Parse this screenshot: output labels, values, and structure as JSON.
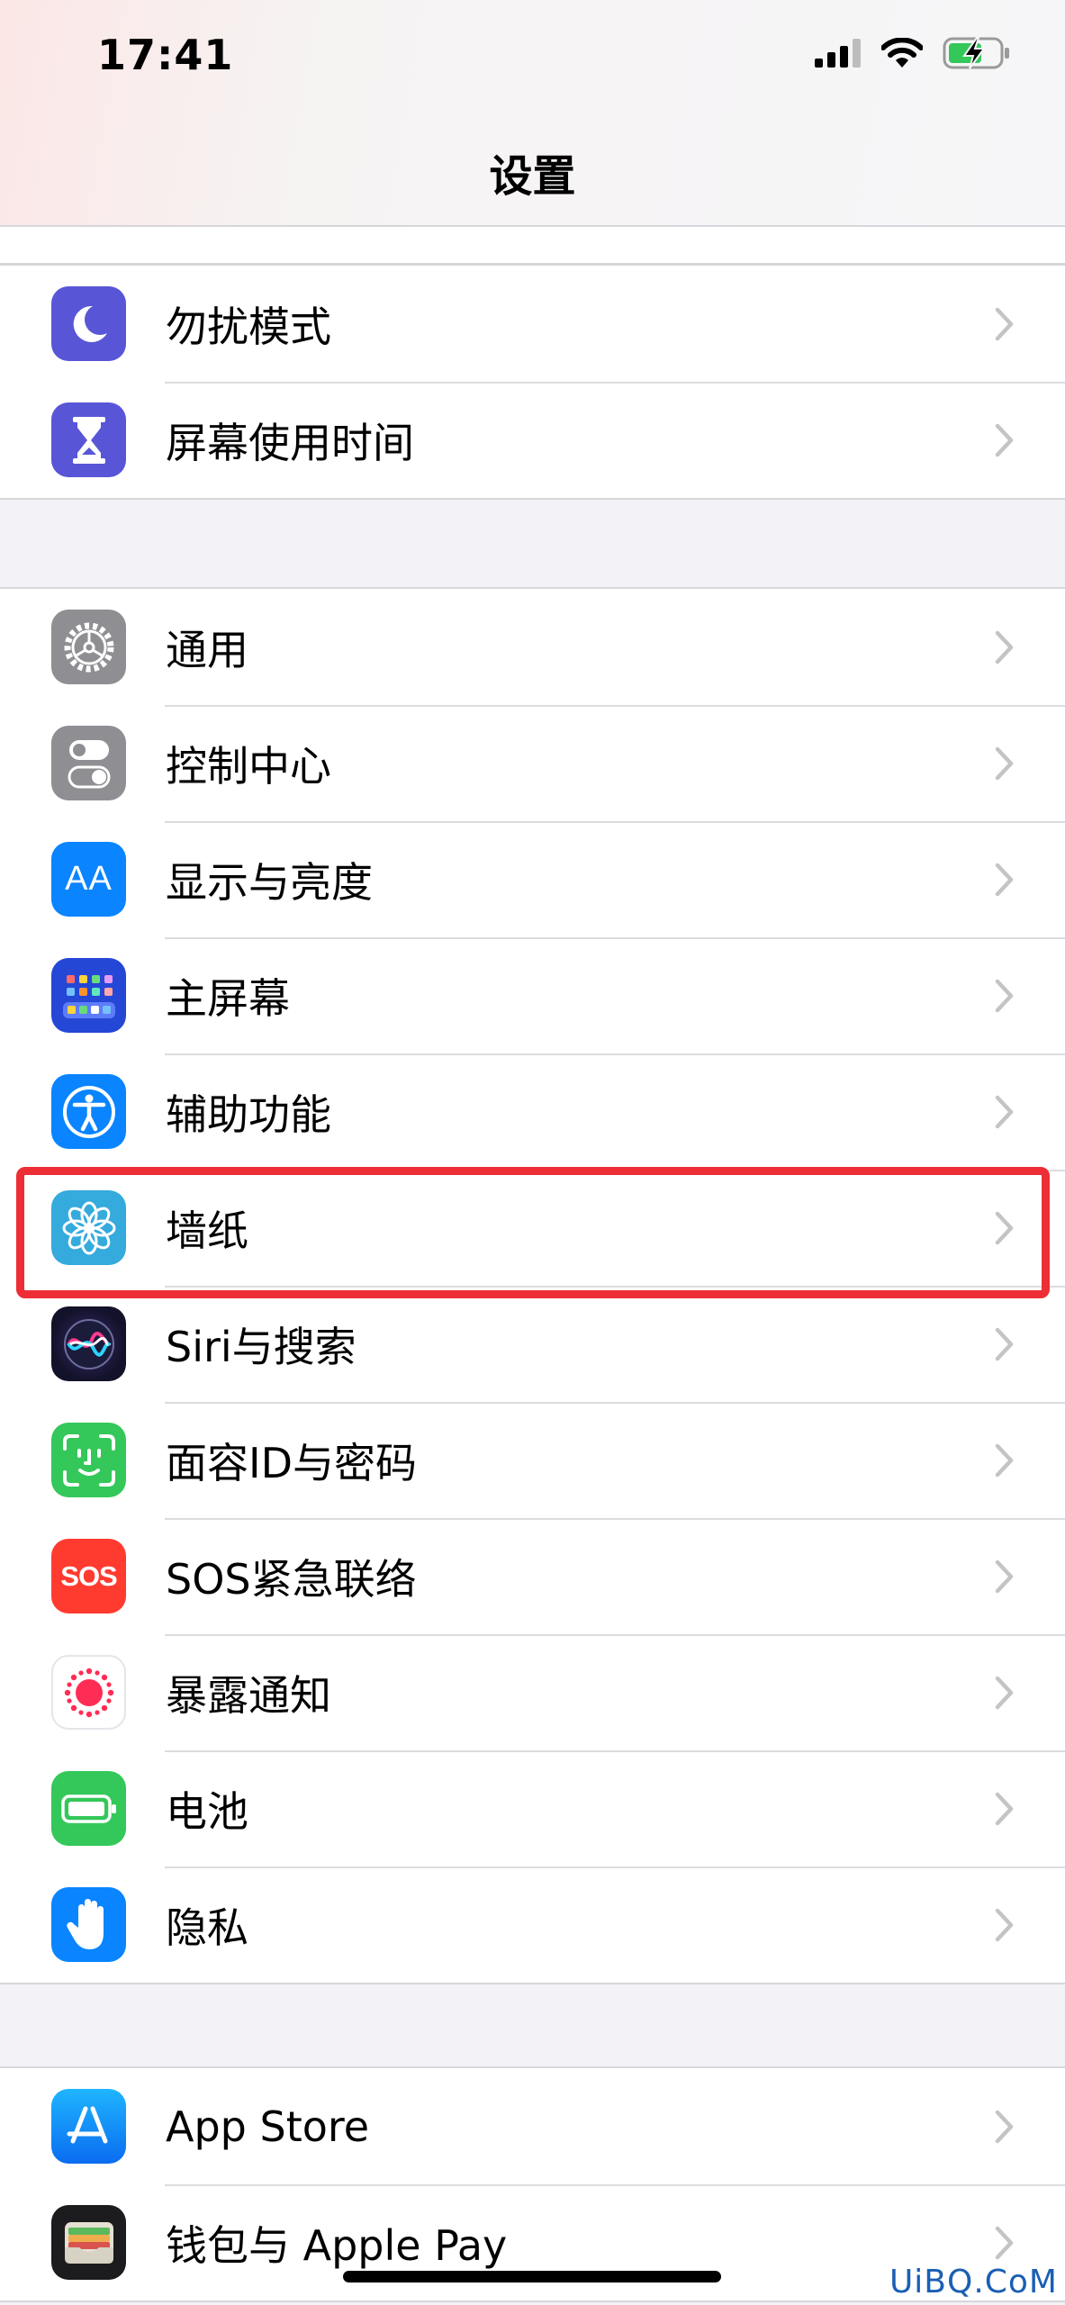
{
  "status_bar": {
    "time": "17:41",
    "icons": [
      "cellular-signal-icon",
      "wifi-icon",
      "battery-charging-icon"
    ]
  },
  "nav": {
    "title": "设置"
  },
  "group1": {
    "items": [
      {
        "label": "勿扰模式",
        "icon": "moon-icon",
        "icon_color": "#5856d6"
      },
      {
        "label": "屏幕使用时间",
        "icon": "hourglass-icon",
        "icon_color": "#5856d6"
      }
    ]
  },
  "group2": {
    "items": [
      {
        "label": "通用",
        "icon": "gear-icon",
        "icon_color": "#8e8e93"
      },
      {
        "label": "控制中心",
        "icon": "toggles-icon",
        "icon_color": "#8e8e93"
      },
      {
        "label": "显示与亮度",
        "icon": "text-size-icon",
        "icon_color": "#0a84ff",
        "icon_text": "AA"
      },
      {
        "label": "主屏幕",
        "icon": "home-grid-icon",
        "icon_color": "#2547d6"
      },
      {
        "label": "辅助功能",
        "icon": "accessibility-icon",
        "icon_color": "#0a84ff"
      },
      {
        "label": "墙纸",
        "icon": "flower-icon",
        "icon_color": "#35aadc"
      },
      {
        "label": "Siri与搜索",
        "icon": "siri-icon",
        "icon_color": "#1c1c3a"
      },
      {
        "label": "面容ID与密码",
        "icon": "face-id-icon",
        "icon_color": "#34c759"
      },
      {
        "label": "SOS紧急联络",
        "icon": "sos-icon",
        "icon_color": "#ff3b30",
        "icon_text": "SOS"
      },
      {
        "label": "暴露通知",
        "icon": "exposure-icon",
        "icon_color": "#ff2d55"
      },
      {
        "label": "电池",
        "icon": "battery-icon",
        "icon_color": "#34c759"
      },
      {
        "label": "隐私",
        "icon": "hand-icon",
        "icon_color": "#0a84ff"
      }
    ]
  },
  "group3": {
    "items": [
      {
        "label": "App Store",
        "icon": "app-store-icon",
        "icon_color": "#0a84ff"
      },
      {
        "label": "钱包与 Apple Pay",
        "icon": "wallet-icon",
        "icon_color": "#1c1c1e"
      }
    ]
  },
  "watermark": "UiBQ.CoM",
  "highlight_color": "#ee2e36"
}
